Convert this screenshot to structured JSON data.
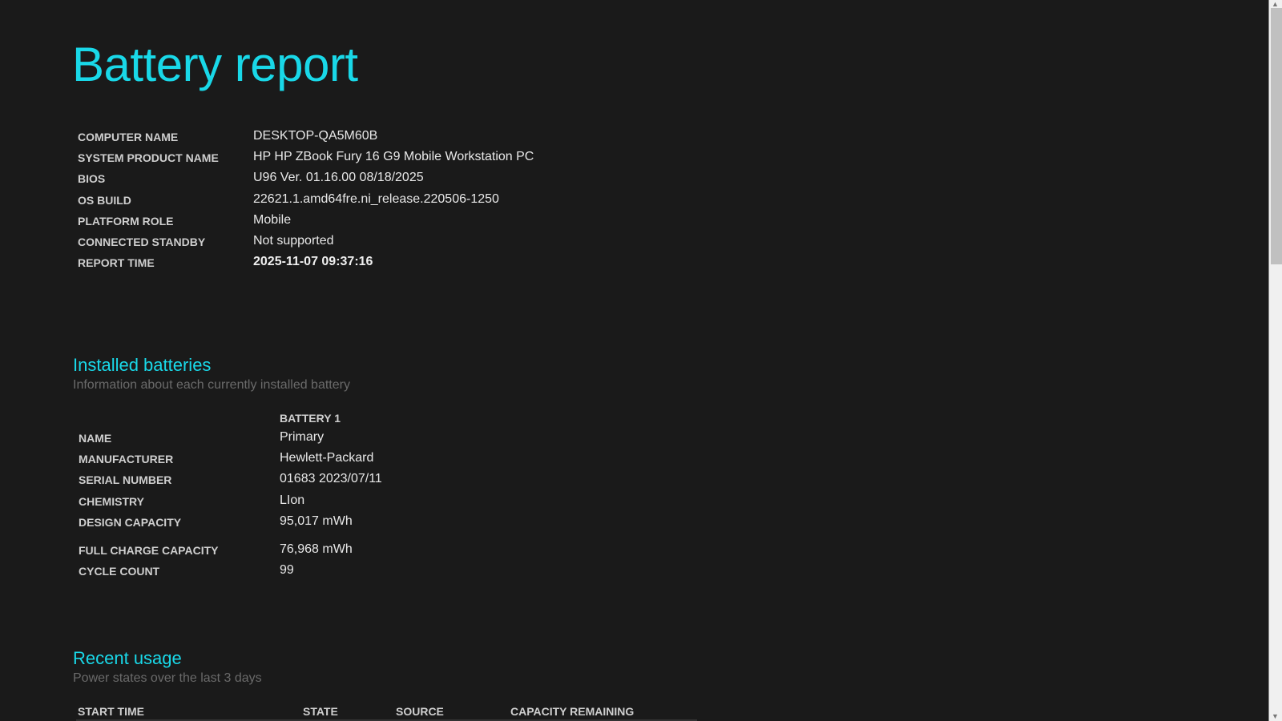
{
  "title": "Battery report",
  "system_info": [
    {
      "label": "COMPUTER NAME",
      "value": "DESKTOP-QA5M60B"
    },
    {
      "label": "SYSTEM PRODUCT NAME",
      "value": "HP HP ZBook Fury 16 G9 Mobile Workstation PC"
    },
    {
      "label": "BIOS",
      "value": "U96 Ver. 01.16.00 08/18/2025"
    },
    {
      "label": "OS BUILD",
      "value": "22621.1.amd64fre.ni_release.220506-1250"
    },
    {
      "label": "PLATFORM ROLE",
      "value": "Mobile"
    },
    {
      "label": "CONNECTED STANDBY",
      "value": "Not supported"
    },
    {
      "label": "REPORT TIME",
      "value": "2025-11-07  09:37:16"
    }
  ],
  "installed_batteries": {
    "heading": "Installed batteries",
    "subtitle": "Information about each currently installed battery",
    "column": "BATTERY 1",
    "rows": [
      {
        "label": "NAME",
        "value": "Primary"
      },
      {
        "label": "MANUFACTURER",
        "value": "Hewlett-Packard"
      },
      {
        "label": "SERIAL NUMBER",
        "value": "01683 2023/07/11"
      },
      {
        "label": "CHEMISTRY",
        "value": "LIon"
      },
      {
        "label": "DESIGN CAPACITY",
        "value": "95,017 mWh"
      },
      {
        "label": "FULL CHARGE CAPACITY",
        "value": "76,968 mWh"
      },
      {
        "label": "CYCLE COUNT",
        "value": "99"
      }
    ]
  },
  "recent_usage": {
    "heading": "Recent usage",
    "subtitle": "Power states over the last 3 days",
    "columns": [
      "START TIME",
      "STATE",
      "SOURCE",
      "CAPACITY REMAINING"
    ]
  }
}
